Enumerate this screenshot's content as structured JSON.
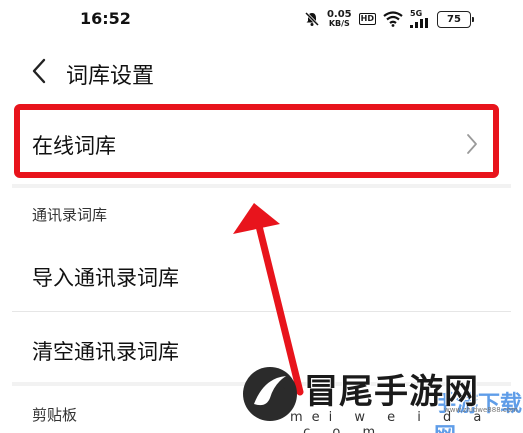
{
  "status_bar": {
    "time": "16:52",
    "speed_value": "0.05",
    "speed_unit": "KB/S",
    "hd_label": "HD",
    "network_label": "5G",
    "battery_level": "75",
    "icons": [
      "bell-mute-icon",
      "wifi-icon",
      "signal-icon",
      "battery-icon"
    ]
  },
  "header": {
    "title": "词库设置",
    "back_icon": "chevron-left-icon"
  },
  "online_item": {
    "label": "在线词库",
    "chevron_icon": "chevron-right-icon",
    "highlight_color": "#e8141c"
  },
  "contacts_section": {
    "title": "通讯录词库",
    "items": [
      {
        "label": "导入通讯录词库"
      },
      {
        "label": "清空通讯录词库"
      }
    ]
  },
  "clipboard_section": {
    "title": "剪贴板"
  },
  "annotation": {
    "arrow_color": "#e8141c"
  },
  "watermark": {
    "brand": "冒尾手游网",
    "url": "mei w e i d a .c o m",
    "url_small": "www.zhidwe888.com",
    "blue_text": "手游下载网"
  }
}
